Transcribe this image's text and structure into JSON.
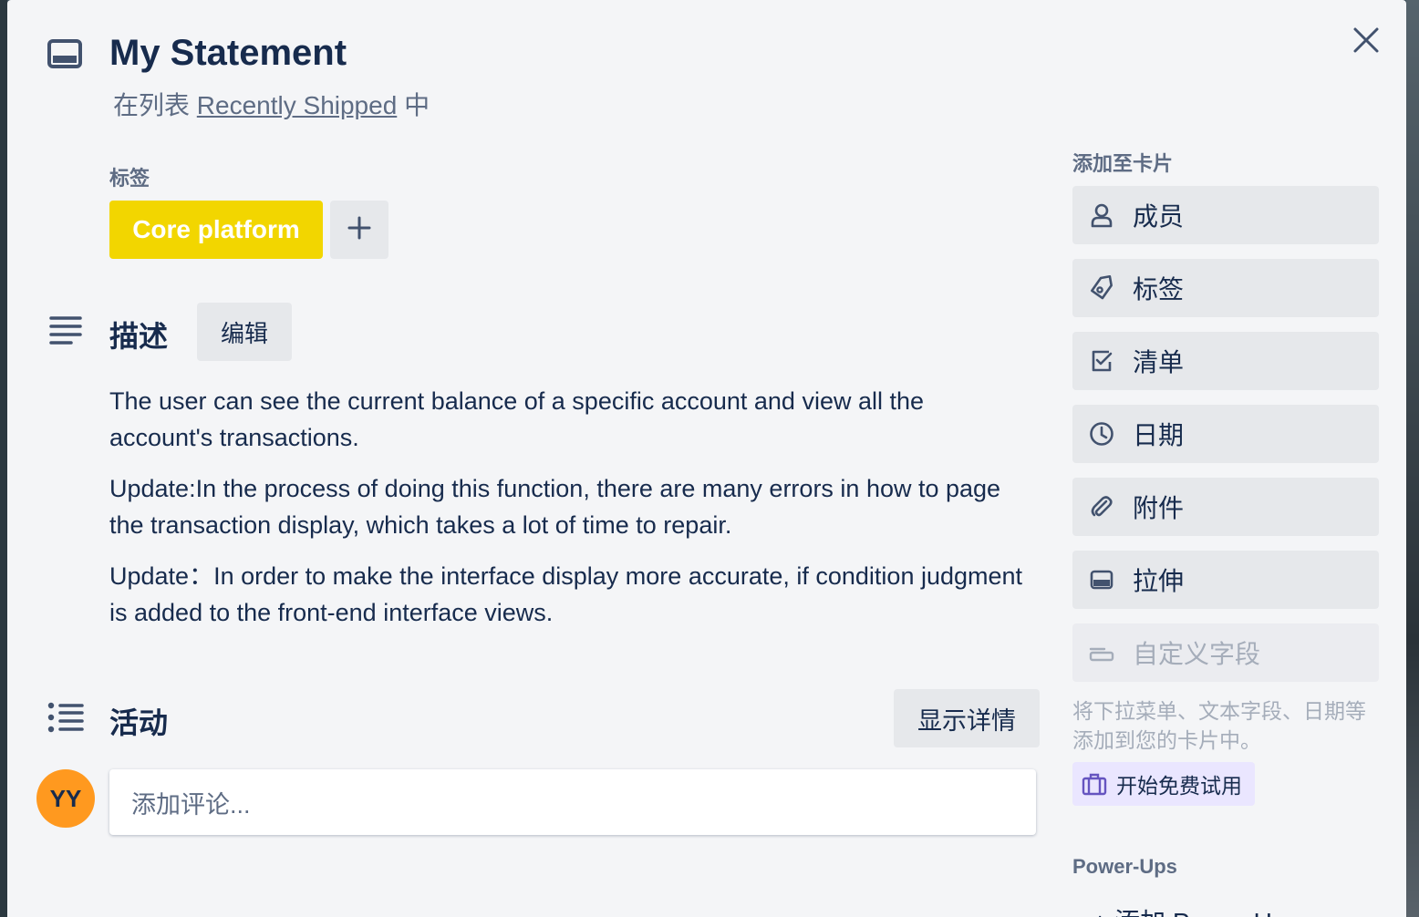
{
  "card": {
    "title": "My Statement",
    "in_list_prefix": "在列表",
    "list_name": "Recently Shipped",
    "in_list_suffix": "中"
  },
  "labels": {
    "heading": "标签",
    "items": [
      {
        "name": "Core platform",
        "color": "#f2d600"
      }
    ]
  },
  "description": {
    "heading": "描述",
    "edit_label": "编辑",
    "paragraphs": [
      "The user can see the current balance of a specific account and view all the account's transactions.",
      "Update:In the process of doing this function, there are many errors in how to page the transaction display, which takes a lot of time to repair.",
      "Update：In order to make the interface display more accurate, if condition judgment is added to the front-end interface views."
    ]
  },
  "activity": {
    "heading": "活动",
    "show_details_label": "显示详情",
    "avatar_initials": "YY",
    "avatar_color": "#ff991f",
    "comment_placeholder": "添加评论..."
  },
  "sidebar": {
    "add_to_card_heading": "添加至卡片",
    "buttons": [
      {
        "label": "成员",
        "icon": "person-icon"
      },
      {
        "label": "标签",
        "icon": "tag-icon"
      },
      {
        "label": "清单",
        "icon": "checklist-icon"
      },
      {
        "label": "日期",
        "icon": "clock-icon"
      },
      {
        "label": "附件",
        "icon": "paperclip-icon"
      },
      {
        "label": "拉伸",
        "icon": "card-cover-icon"
      }
    ],
    "custom_fields_label": "自定义字段",
    "custom_fields_hint": "将下拉菜单、文本字段、日期等添加到您的卡片中。",
    "trial_label": "开始免费试用",
    "powerups_heading": "Power-Ups",
    "add_powerups_label": "+ 添加 Power-Ups"
  },
  "colors": {
    "background": "#f4f5f7",
    "button": "#e6e8eb",
    "text": "#172b4d",
    "muted": "#5e6c84",
    "trial_bg": "#eae6ff"
  }
}
